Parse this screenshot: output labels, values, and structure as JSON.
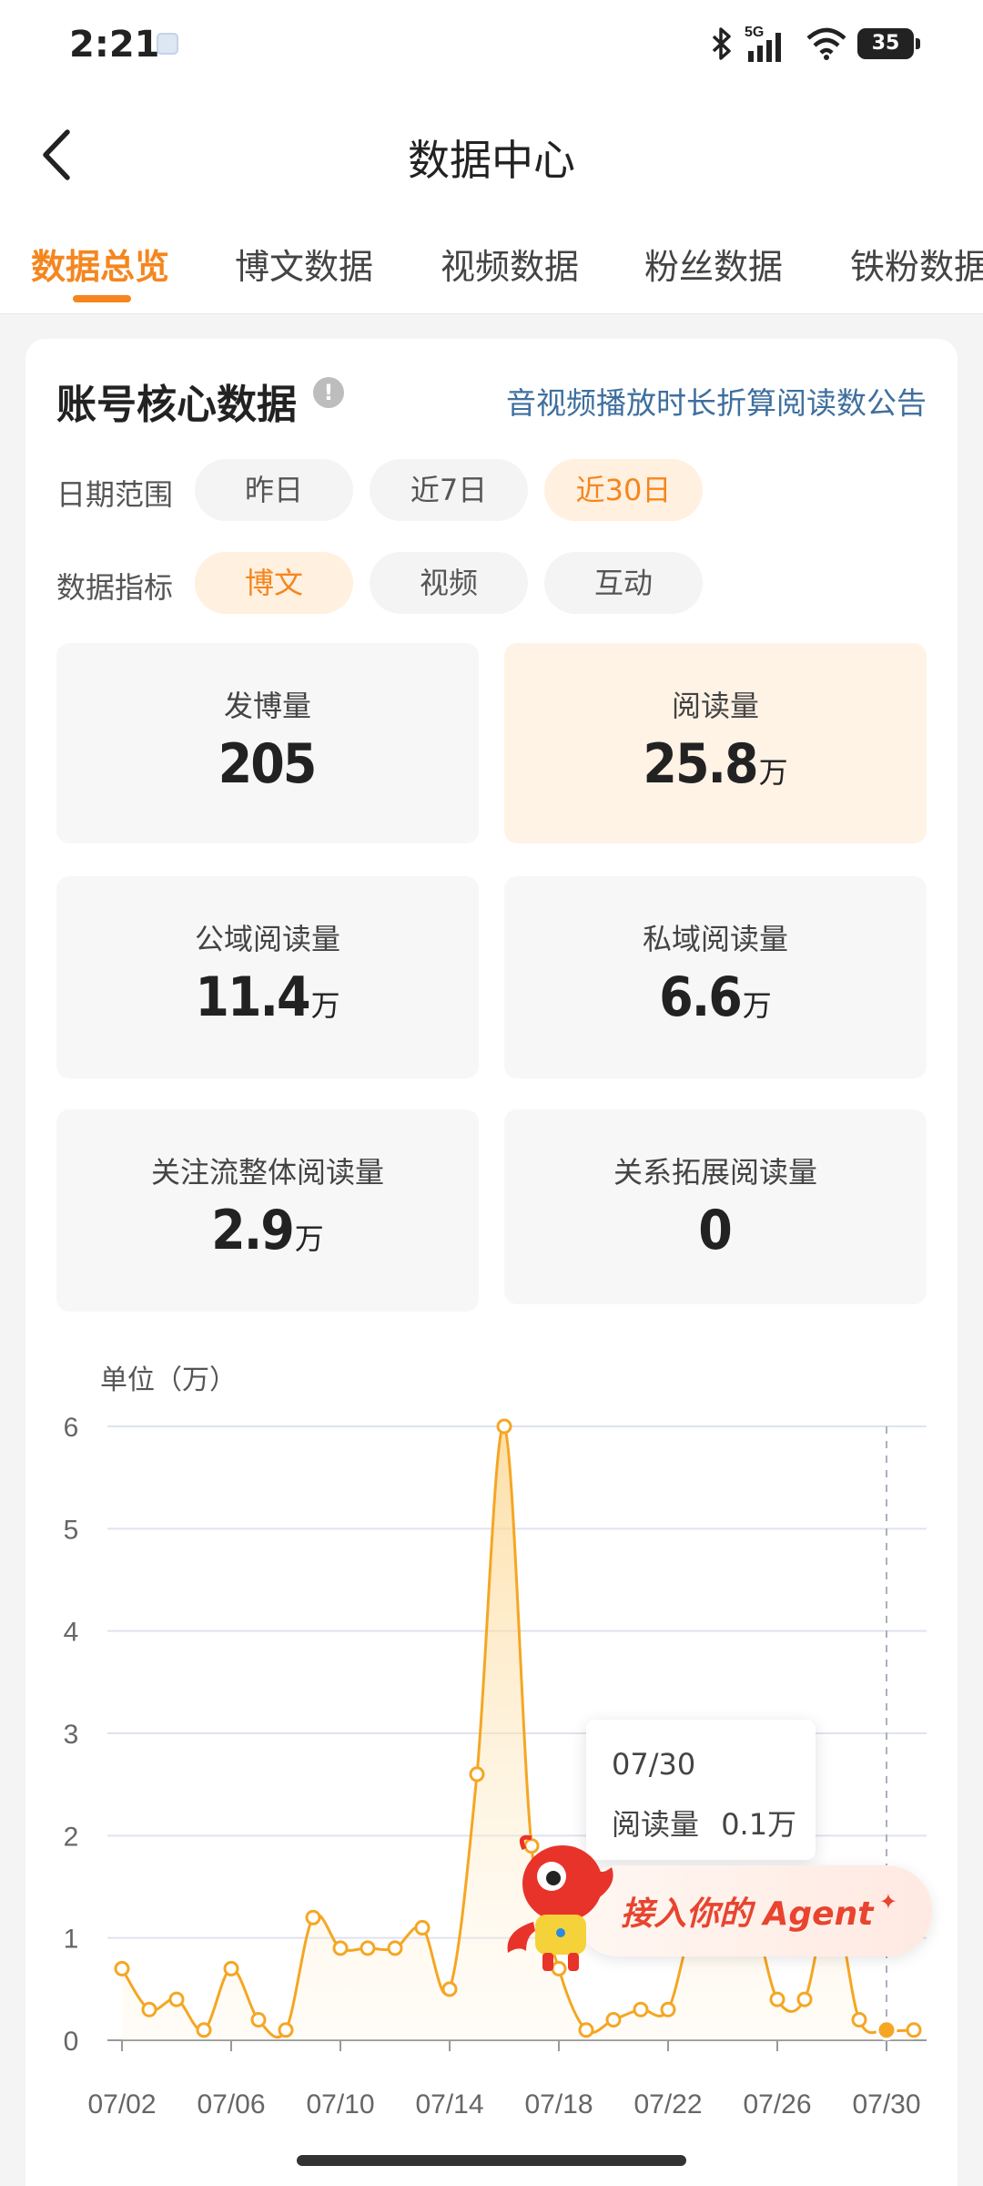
{
  "status_bar": {
    "time": "2:21",
    "network": "5G",
    "battery": "35"
  },
  "navbar": {
    "title": "数据中心",
    "back_icon": "chevron-left-icon"
  },
  "tabs": [
    {
      "label": "数据总览",
      "active": true
    },
    {
      "label": "博文数据",
      "active": false
    },
    {
      "label": "视频数据",
      "active": false
    },
    {
      "label": "粉丝数据",
      "active": false
    },
    {
      "label": "铁粉数据",
      "active": false
    }
  ],
  "card": {
    "title": "账号核心数据",
    "notice_link": "音视频播放时长折算阅读数公告",
    "date_range": {
      "label": "日期范围",
      "options": [
        "昨日",
        "近7日",
        "近30日"
      ],
      "selected": "近30日"
    },
    "metric_type": {
      "label": "数据指标",
      "options": [
        "博文",
        "视频",
        "互动"
      ],
      "selected": "博文"
    },
    "metrics": [
      {
        "label": "发博量",
        "value": "205",
        "unit": ""
      },
      {
        "label": "阅读量",
        "value": "25.8",
        "unit": "万"
      },
      {
        "label": "公域阅读量",
        "value": "11.4",
        "unit": "万"
      },
      {
        "label": "私域阅读量",
        "value": "6.6",
        "unit": "万"
      },
      {
        "label": "关注流整体阅读量",
        "value": "2.9",
        "unit": "万"
      },
      {
        "label": "关系拓展阅读量",
        "value": "0",
        "unit": ""
      }
    ]
  },
  "chart_unit_label": "单位（万）",
  "tooltip": {
    "date": "07/30",
    "label": "阅读量",
    "value": "0.1万"
  },
  "agent_banner": {
    "text": "接入你的 Agent"
  },
  "chart_data": {
    "type": "line",
    "ylabel": "单位（万）",
    "ylim": [
      0,
      6
    ],
    "yticks": [
      0,
      1,
      2,
      3,
      4,
      5,
      6
    ],
    "xtick_labels": [
      "07/02",
      "07/06",
      "07/10",
      "07/14",
      "07/18",
      "07/22",
      "07/26",
      "07/30"
    ],
    "x": [
      "07/02",
      "07/03",
      "07/04",
      "07/05",
      "07/06",
      "07/07",
      "07/08",
      "07/09",
      "07/10",
      "07/11",
      "07/12",
      "07/13",
      "07/14",
      "07/15",
      "07/16",
      "07/17",
      "07/18",
      "07/19",
      "07/20",
      "07/21",
      "07/22",
      "07/23",
      "07/24",
      "07/25",
      "07/26",
      "07/27",
      "07/28",
      "07/29",
      "07/30",
      "07/31"
    ],
    "series": [
      {
        "values": [
          0.7,
          0.3,
          0.4,
          0.1,
          0.7,
          0.2,
          0.1,
          1.2,
          0.9,
          0.9,
          0.9,
          1.1,
          0.5,
          2.6,
          6.0,
          1.9,
          0.7,
          0.1,
          0.2,
          0.3,
          0.3,
          1.2,
          1.1,
          1.3,
          0.4,
          0.4,
          1.4,
          0.2,
          0.1,
          0.1
        ],
        "color": "#f5a623",
        "fill": "area"
      }
    ],
    "highlight": {
      "x": "07/30",
      "value": 0.1
    },
    "grid": true
  }
}
